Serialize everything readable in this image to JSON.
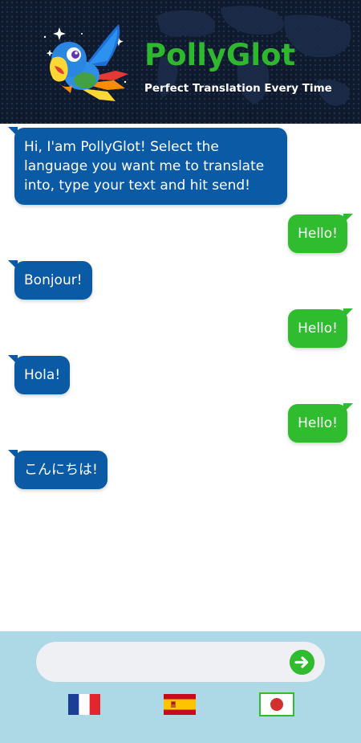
{
  "header": {
    "title": "PollyGlot",
    "subtitle": "Perfect Translation Every Time",
    "logo_icon": "parrot-icon"
  },
  "chat": {
    "messages": [
      {
        "from": "bot",
        "text": "Hi, I'am PollyGlot! Select the language you want me to translate into, type your text and hit send!"
      },
      {
        "from": "user",
        "text": "Hello!"
      },
      {
        "from": "bot",
        "text": "Bonjour!"
      },
      {
        "from": "user",
        "text": "Hello!"
      },
      {
        "from": "bot",
        "text": "Hola!"
      },
      {
        "from": "user",
        "text": "Hello!"
      },
      {
        "from": "bot",
        "text": "こんにちは!"
      }
    ]
  },
  "composer": {
    "value": "",
    "placeholder": "",
    "send_icon": "arrow-right-icon"
  },
  "languages": [
    {
      "code": "fr",
      "name": "French",
      "icon": "france-flag-icon",
      "selected": false
    },
    {
      "code": "es",
      "name": "Spanish",
      "icon": "spain-flag-icon",
      "selected": false
    },
    {
      "code": "ja",
      "name": "Japanese",
      "icon": "japan-flag-icon",
      "selected": true
    }
  ],
  "colors": {
    "header_bg": "#0f1a2e",
    "brand_green": "#2fb82f",
    "bot_bubble": "#0b5aa6",
    "user_bubble": "#2fbd2f",
    "footer_bg": "#add8e6"
  }
}
